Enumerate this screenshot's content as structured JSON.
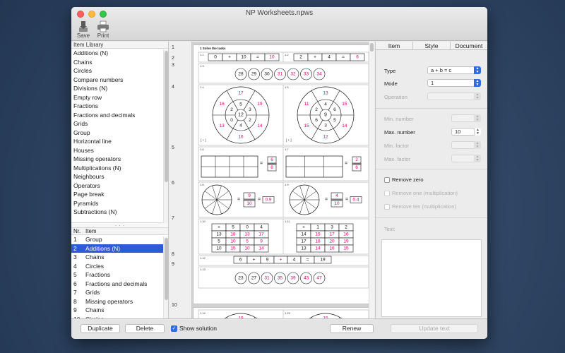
{
  "window": {
    "title": "NP Worksheets.npws"
  },
  "toolbar": {
    "save_label": "Save",
    "print_label": "Print"
  },
  "library": {
    "header": "Item Library",
    "items": [
      "Additions (N)",
      "Chains",
      "Circles",
      "Compare numbers",
      "Divisions (N)",
      "Empty row",
      "Fractions",
      "Fractions and decimals",
      "Grids",
      "Group",
      "Horizontal line",
      "Houses",
      "Missing operators",
      "Multiplications (N)",
      "Neighbours",
      "Operators",
      "Page break",
      "Pyramids",
      "Subtractions (N)"
    ],
    "split_handle": "· · ·"
  },
  "item_list": {
    "col_nr": "Nr.",
    "col_item": "Item",
    "rows": [
      {
        "nr": "1",
        "item": "Group"
      },
      {
        "nr": "2",
        "item": "Additions (N)"
      },
      {
        "nr": "3",
        "item": "Chains"
      },
      {
        "nr": "4",
        "item": "Circles"
      },
      {
        "nr": "5",
        "item": "Fractions"
      },
      {
        "nr": "6",
        "item": "Fractions and decimals"
      },
      {
        "nr": "7",
        "item": "Grids"
      },
      {
        "nr": "8",
        "item": "Missing operators"
      },
      {
        "nr": "9",
        "item": "Chains"
      },
      {
        "nr": "10",
        "item": "Circles"
      }
    ],
    "selected_index": 1
  },
  "worksheet": {
    "row_numbers": [
      "1",
      "2",
      "3",
      "4",
      "5",
      "6",
      "7",
      "8",
      "9",
      "10"
    ],
    "group_title": "1 Solve the tasks",
    "labels": {
      "t11": "1.1",
      "t12": "1.2",
      "t13": "1.3",
      "t14": "1.4",
      "t15": "1.5",
      "t16": "1.6",
      "t17": "1.7",
      "t18": "1.8",
      "t19": "1.9",
      "t110": "1.10",
      "t111": "1.11",
      "t112": "1.12",
      "t113": "1.13",
      "t114": "1.14",
      "t115": "1.15"
    },
    "add1": [
      "0",
      "+",
      "10",
      "=",
      "10"
    ],
    "add2": [
      "2",
      "+",
      "4",
      "=",
      "6"
    ],
    "chain1": [
      "28",
      "29",
      "30",
      "31",
      "32",
      "33",
      "34"
    ],
    "chain1_given": 3,
    "circle1": {
      "center": "12",
      "inner": [
        "5",
        "3",
        "2",
        "4",
        "0",
        "2"
      ],
      "outer": [
        "17",
        "19",
        "14",
        "16",
        "13",
        "16"
      ],
      "footer": "[ + ]"
    },
    "circle2": {
      "center": "9",
      "inner": [
        "4",
        "6",
        "5",
        "3",
        "6",
        "2"
      ],
      "outer": [
        "13",
        "15",
        "14",
        "12",
        "15",
        "11"
      ],
      "footer": "[ + ]"
    },
    "frac1": {
      "num": "6",
      "den": "8",
      "eq": "="
    },
    "frac2": {
      "num": "2",
      "den": "6",
      "eq": "="
    },
    "fd1": {
      "num": "9",
      "den": "10",
      "dec": "0.9",
      "eq": "="
    },
    "fd2": {
      "num": "4",
      "den": "10",
      "dec": "0.4",
      "eq": "="
    },
    "grid1": [
      [
        "+",
        "5",
        "0",
        "4"
      ],
      [
        "13",
        "18",
        "13",
        "17"
      ],
      [
        "5",
        "10",
        "5",
        "9"
      ],
      [
        "10",
        "15",
        "10",
        "14"
      ]
    ],
    "grid2": [
      [
        "+",
        "1",
        "3",
        "2"
      ],
      [
        "14",
        "15",
        "17",
        "16"
      ],
      [
        "17",
        "18",
        "20",
        "19"
      ],
      [
        "13",
        "14",
        "16",
        "15"
      ]
    ],
    "missing_ops": [
      "6",
      "+",
      "9",
      "+",
      "4",
      "=",
      "19"
    ],
    "chain2": [
      "23",
      "27",
      "31",
      "35",
      "39",
      "43",
      "47"
    ],
    "chain2_given": 2,
    "circle3_top": "19",
    "circle4_top": "15"
  },
  "properties": {
    "tabs": [
      "Item",
      "Style",
      "Document"
    ],
    "type_label": "Type",
    "type_value": "a + b = c",
    "mode_label": "Mode",
    "mode_value": "1",
    "operation_label": "Operation",
    "min_number_label": "Min. number",
    "max_number_label": "Max. number",
    "max_number_value": "10",
    "min_factor_label": "Min. factor",
    "max_factor_label": "Max. factor",
    "remove_zero": "Remove zero",
    "remove_one": "Remove one (multiplication)",
    "remove_ten": "Remove ten (multiplication)",
    "text_label": "Text:"
  },
  "bottom": {
    "duplicate": "Duplicate",
    "delete": "Delete",
    "show_solution": "Show solution",
    "renew": "Renew",
    "update_text": "Update text"
  },
  "colors": {
    "solution": "#e0006e",
    "selection": "#2b5bd7",
    "accent": "#2f6de0"
  }
}
